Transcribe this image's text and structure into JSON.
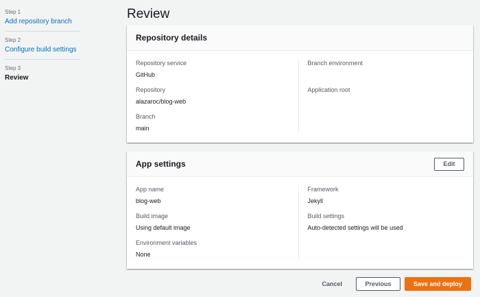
{
  "wizard": {
    "steps": [
      {
        "number": "Step 1",
        "label": "Add repository branch"
      },
      {
        "number": "Step 2",
        "label": "Configure build settings"
      },
      {
        "number": "Step 3",
        "label": "Review"
      }
    ]
  },
  "page": {
    "title": "Review"
  },
  "repository_details": {
    "title": "Repository details",
    "left": [
      {
        "label": "Repository service",
        "value": "GitHub"
      },
      {
        "label": "Repository",
        "value": "alazaroc/blog-web"
      },
      {
        "label": "Branch",
        "value": "main"
      }
    ],
    "right": [
      {
        "label": "Branch environment",
        "value": ""
      },
      {
        "label": "Application root",
        "value": ""
      }
    ]
  },
  "app_settings": {
    "title": "App settings",
    "edit_label": "Edit",
    "left": [
      {
        "label": "App name",
        "value": "blog-web"
      },
      {
        "label": "Build image",
        "value": "Using default image"
      },
      {
        "label": "Environment variables",
        "value": "None"
      }
    ],
    "right": [
      {
        "label": "Framework",
        "value": "Jekyll"
      },
      {
        "label": "Build settings",
        "value": "Auto-detected settings will be used"
      }
    ]
  },
  "footer": {
    "cancel_label": "Cancel",
    "previous_label": "Previous",
    "deploy_label": "Save and deploy"
  },
  "colors": {
    "link": "#0073bb",
    "primary": "#ec7211",
    "background": "#f2f3f3"
  }
}
